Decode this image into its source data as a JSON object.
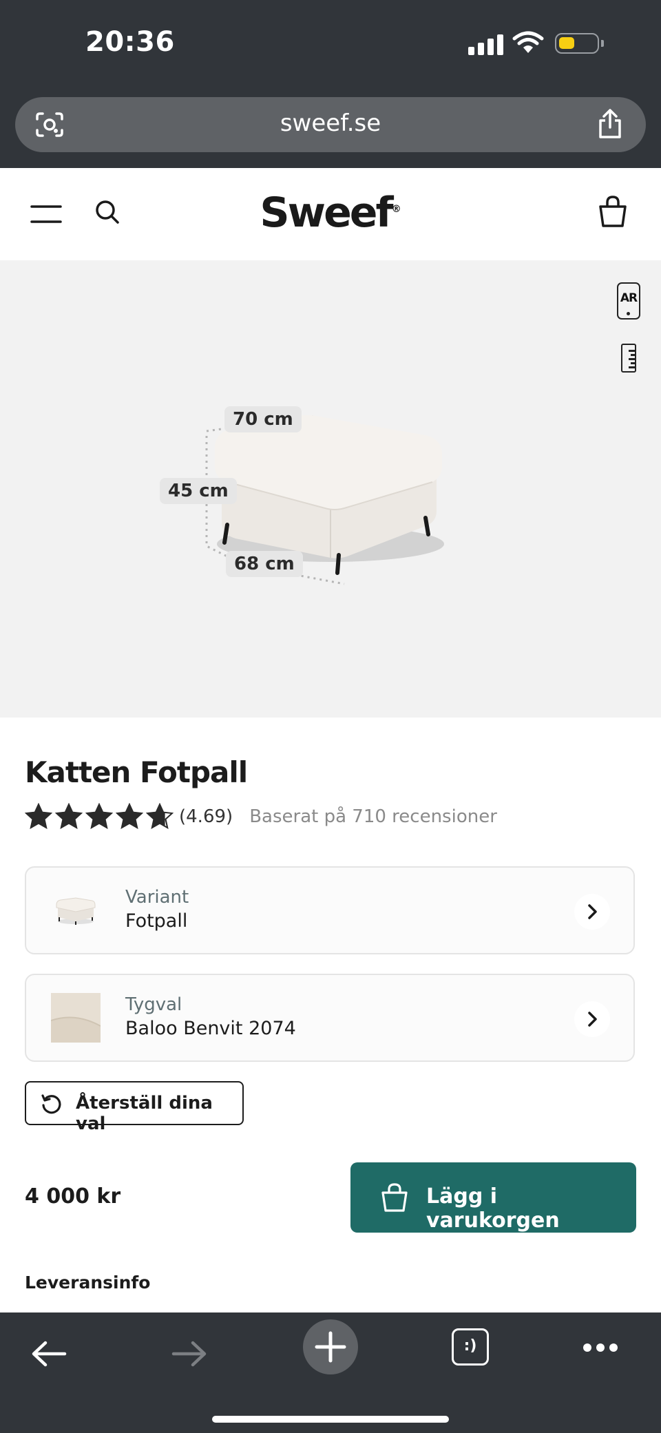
{
  "status_bar": {
    "time": "20:36",
    "battery_level": 0.42,
    "battery_color": "#f7cf13"
  },
  "browser": {
    "url": "sweef.se"
  },
  "header": {
    "logo": "Sweef",
    "logo_mark": "®"
  },
  "hero": {
    "ar_label": "AR",
    "dimensions": {
      "width": "70 cm",
      "height": "45 cm",
      "depth": "68 cm"
    }
  },
  "product": {
    "title": "Katten Fotpall",
    "rating": 4.69,
    "rating_text": "(4.69)",
    "reviews_text": "Baserat på 710 recensioner",
    "options": [
      {
        "label": "Variant",
        "value": "Fotpall"
      },
      {
        "label": "Tygval",
        "value": "Baloo Benvit 2074"
      }
    ],
    "reset_label": "Återställ dina val",
    "price": "4 000 kr",
    "add_to_cart_label": "Lägg i varukorgen",
    "delivery_heading": "Leveransinfo"
  },
  "colors": {
    "accent": "#1f6b66",
    "chrome": "#31353a"
  },
  "toolbar": {
    "tabs_label": ":)"
  }
}
